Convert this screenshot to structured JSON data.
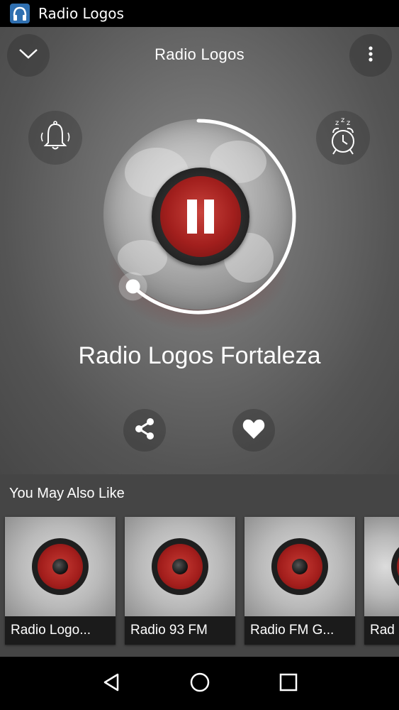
{
  "status_bar": {
    "app_title": "Radio Logos",
    "icon": "app-logo-icon"
  },
  "header": {
    "title": "Radio Logos",
    "collapse_icon": "chevron-down-icon",
    "menu_icon": "more-vert-icon"
  },
  "player": {
    "alarm_icon": "bell-icon",
    "sleep_icon": "sleep-timer-icon",
    "play_state_icon": "pause-icon",
    "progress": 0.62,
    "station_name": "Radio Logos Fortaleza",
    "share_icon": "share-icon",
    "favorite_icon": "heart-icon"
  },
  "recommendations": {
    "title": "You May Also Like",
    "items": [
      {
        "label": "Radio Logo..."
      },
      {
        "label": "Radio 93 FM"
      },
      {
        "label": "Radio FM G..."
      },
      {
        "label": "Rad"
      }
    ]
  },
  "nav": {
    "back_icon": "back-icon",
    "home_icon": "home-icon",
    "recents_icon": "recents-icon"
  },
  "colors": {
    "accent_red": "#a21f1d",
    "background": "#6f6f6f",
    "section_bg": "#454545"
  }
}
